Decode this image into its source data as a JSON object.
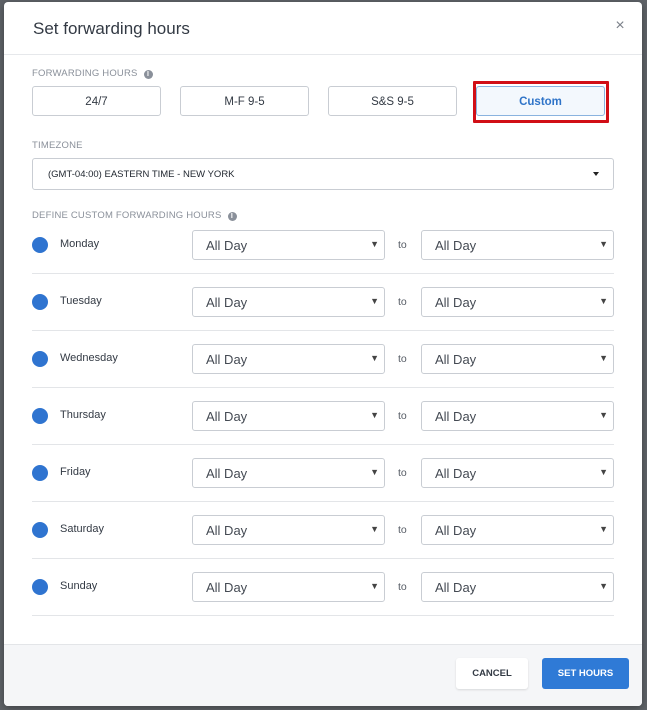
{
  "dialog": {
    "title": "Set forwarding hours",
    "close_glyph": "×"
  },
  "forwarding_hours": {
    "label": "FORWARDING HOURS",
    "presets": [
      {
        "label": "24/7",
        "selected": false
      },
      {
        "label": "M-F 9-5",
        "selected": false
      },
      {
        "label": "S&S 9-5",
        "selected": false
      },
      {
        "label": "Custom",
        "selected": true
      }
    ]
  },
  "timezone": {
    "label": "TIMEZONE",
    "value": "(GMT-04:00) EASTERN TIME - NEW YORK"
  },
  "custom_hours": {
    "label": "DEFINE CUSTOM FORWARDING HOURS",
    "to_label": "to",
    "days": [
      {
        "day": "Monday",
        "from": "All Day",
        "to": "All Day"
      },
      {
        "day": "Tuesday",
        "from": "All Day",
        "to": "All Day"
      },
      {
        "day": "Wednesday",
        "from": "All Day",
        "to": "All Day"
      },
      {
        "day": "Thursday",
        "from": "All Day",
        "to": "All Day"
      },
      {
        "day": "Friday",
        "from": "All Day",
        "to": "All Day"
      },
      {
        "day": "Saturday",
        "from": "All Day",
        "to": "All Day"
      },
      {
        "day": "Sunday",
        "from": "All Day",
        "to": "All Day"
      }
    ]
  },
  "footer": {
    "cancel_label": "CANCEL",
    "submit_label": "SET HOURS"
  },
  "colors": {
    "accent": "#2f7ad6",
    "highlight": "#d10e16"
  }
}
